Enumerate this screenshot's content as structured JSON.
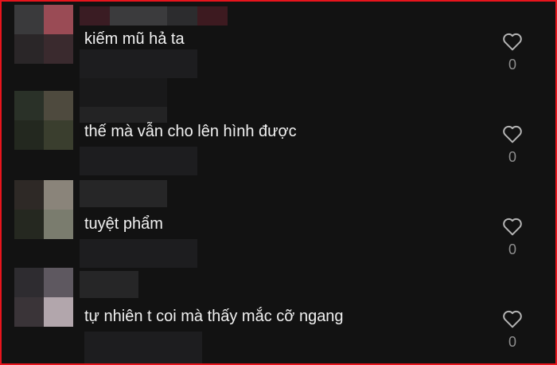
{
  "comments": [
    {
      "text": "kiếm mũ hả ta",
      "likes": "0"
    },
    {
      "text": "thế mà vẫn cho lên hình được",
      "likes": "0"
    },
    {
      "text": "tuyệt phẩm",
      "likes": "0"
    },
    {
      "text": "tự nhiên t coi mà thấy mắc cỡ ngang",
      "likes": "0"
    }
  ],
  "icons": {
    "like": "heart-outline-icon"
  },
  "colors": {
    "background": "#121212",
    "text": "#f1f1f1",
    "count": "#8f8f8f",
    "border": "#e8141c"
  }
}
